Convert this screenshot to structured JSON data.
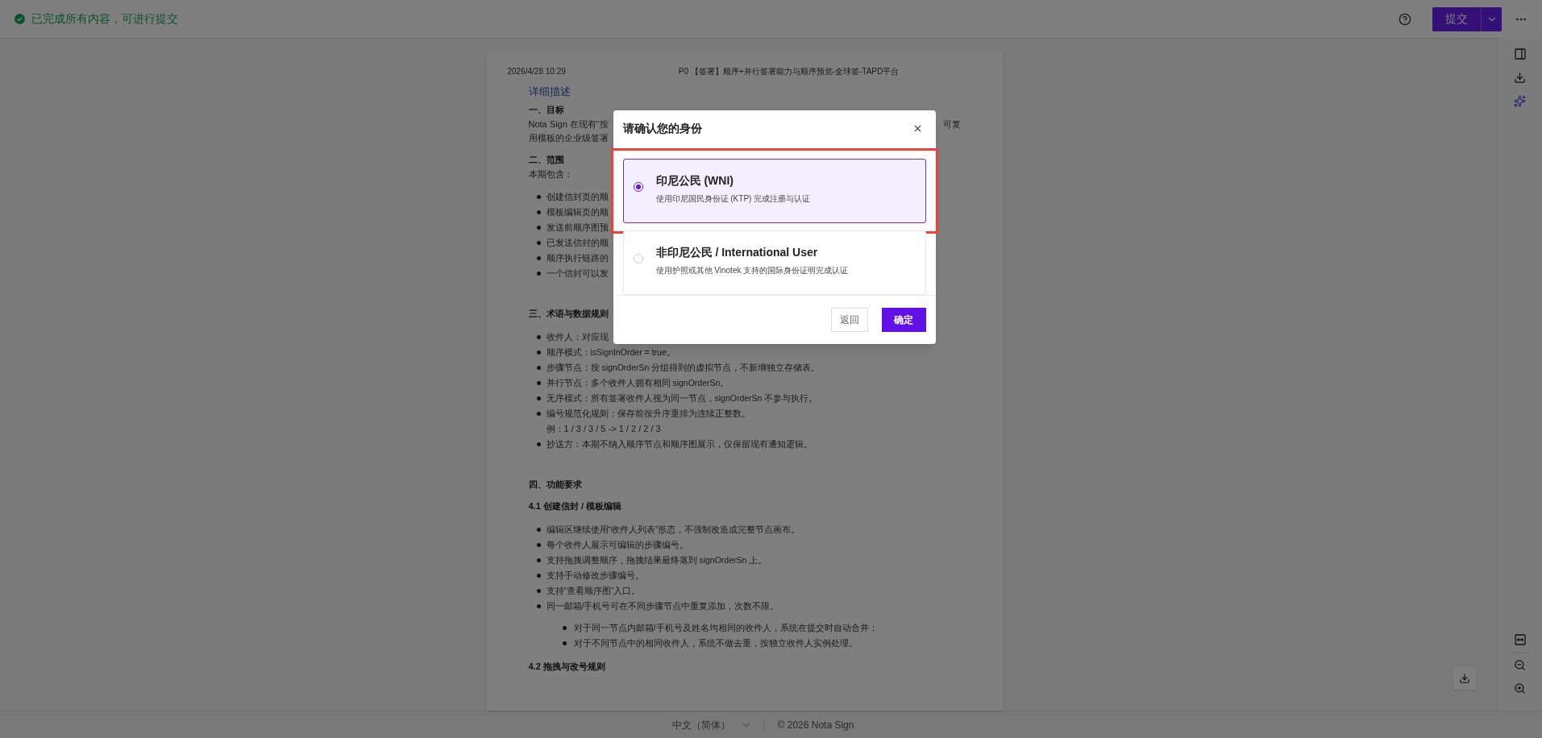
{
  "top_bar": {
    "status": "已完成所有内容，可进行提交",
    "submit": "提交"
  },
  "document": {
    "timestamp": "2026/4/28 10:29",
    "title": "P0 【签署】顺序+并行签署能力与顺序预览-全球签-TAPD平台",
    "section_title": "详细描述",
    "blocks": [
      {
        "kind": "heading",
        "text": "一、目标"
      },
      {
        "kind": "split",
        "left": "Nota Sign 在现有“按",
        "right": "可复"
      },
      {
        "kind": "paragraph",
        "text": "用模板的企业级签署"
      },
      {
        "kind": "heading",
        "text": "二、范围"
      },
      {
        "kind": "paragraph",
        "text": "本期包含："
      },
      {
        "kind": "bullet",
        "text": "创建信封页的顺"
      },
      {
        "kind": "bullet",
        "text": "模板编辑页的顺"
      },
      {
        "kind": "bullet",
        "text": "发送前顺序图预"
      },
      {
        "kind": "bullet",
        "text": "已发送信封的顺"
      },
      {
        "kind": "bullet",
        "text": "顺序执行链路的"
      },
      {
        "kind": "bullet",
        "text": "一个信封可以发"
      },
      {
        "kind": "heading",
        "text": "三、术语与数据规则"
      },
      {
        "kind": "bullet",
        "text": "收件人：对应现"
      },
      {
        "kind": "bullet",
        "text": "顺序模式：isSignInOrder = true。"
      },
      {
        "kind": "bullet",
        "text": "步骤节点：按 signOrderSn 分组得到的虚拟节点，不新增独立存储表。"
      },
      {
        "kind": "bullet",
        "text": "并行节点：多个收件人拥有相同 signOrderSn。"
      },
      {
        "kind": "bullet",
        "text": "无序模式：所有签署收件人视为同一节点，signOrderSn 不参与执行。"
      },
      {
        "kind": "bullet",
        "text": "编号规范化规则：保存前按升序重排为连续正整数。"
      },
      {
        "kind": "indent",
        "text": "例：1 / 3 / 3 / 5 -> 1 / 2 / 2 / 3"
      },
      {
        "kind": "bullet",
        "text": "抄送方：本期不纳入顺序节点和顺序图展示，仅保留现有通知逻辑。"
      },
      {
        "kind": "heading",
        "text": "四、功能要求"
      },
      {
        "kind": "subheading",
        "text": "4.1 创建信封 / 模板编辑"
      },
      {
        "kind": "bullet",
        "text": "编辑区继续使用“收件人列表”形态，不强制改造成完整节点画布。"
      },
      {
        "kind": "bullet",
        "text": "每个收件人展示可编辑的步骤编号。"
      },
      {
        "kind": "bullet",
        "text": "支持拖拽调整顺序，拖拽结果最终落到 signOrderSn 上。"
      },
      {
        "kind": "bullet",
        "text": "支持手动修改步骤编号。"
      },
      {
        "kind": "bullet",
        "text": "支持“查看顺序图”入口。"
      },
      {
        "kind": "bullet",
        "text": "同一邮箱/手机号可在不同步骤节点中重复添加，次数不限。"
      },
      {
        "kind": "sub_bullet",
        "text": "对于同一节点内邮箱/手机号及姓名均相同的收件人，系统在提交时自动合并；"
      },
      {
        "kind": "sub_bullet",
        "text": "对于不同节点中的相同收件人，系统不做去重，按独立收件人实例处理。"
      },
      {
        "kind": "subheading",
        "text": "4.2 拖拽与改号规则"
      }
    ]
  },
  "footer": {
    "language": "中文（简体）",
    "copyright": "© 2026 Nota Sign"
  },
  "dialog": {
    "title": "请确认您的身份",
    "options": [
      {
        "title": "印尼公民 (WNI)",
        "description": "使用印尼国民身份证 (KTP) 完成注册与认证",
        "selected": true
      },
      {
        "title": "非印尼公民 / International User",
        "description": "使用护照或其他 Vinotek 支持的国际身份证明完成认证",
        "selected": false
      }
    ],
    "cancel": "返回",
    "confirm": "确定"
  }
}
